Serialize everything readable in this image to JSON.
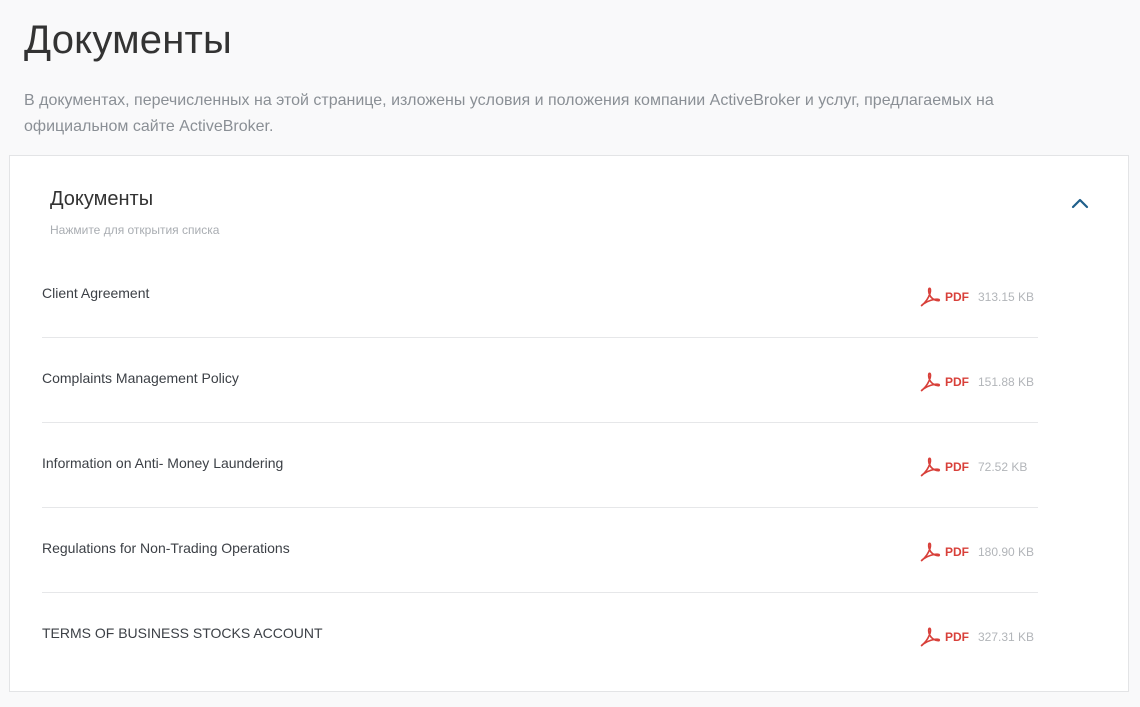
{
  "page": {
    "title": "Документы",
    "intro": "В документах, перечисленных на этой странице, изложены условия и положения компании ActiveBroker и услуг, предлагаемых на официальном сайте ActiveBroker."
  },
  "panel": {
    "title": "Документы",
    "subtitle": "Нажмите для открытия списка",
    "toggle_icon": "chevron-up-icon",
    "accent_color": "#1f5f8b"
  },
  "documents": [
    {
      "name": "Client Agreement",
      "type": "PDF",
      "size": "313.15 KB"
    },
    {
      "name": "Complaints Management Policy",
      "type": "PDF",
      "size": "151.88 KB"
    },
    {
      "name": "Information on Anti- Money Laundering",
      "type": "PDF",
      "size": "72.52 KB"
    },
    {
      "name": "Regulations for Non-Trading Operations",
      "type": "PDF",
      "size": "180.90 KB"
    },
    {
      "name": "TERMS OF BUSINESS STOCKS ACCOUNT",
      "type": "PDF",
      "size": "327.31 KB"
    }
  ],
  "colors": {
    "pdf_red": "#d8403a",
    "muted_text": "#8a8f95"
  }
}
